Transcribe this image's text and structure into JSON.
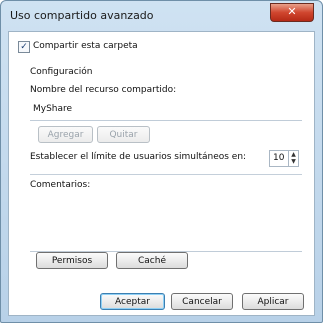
{
  "window": {
    "title": "Uso compartido avanzado",
    "close_symbol": "✕"
  },
  "share": {
    "checkbox_label": "Compartir esta carpeta",
    "checked": true
  },
  "config": {
    "section_label": "Configuración",
    "share_name_label": "Nombre del recurso compartido:",
    "share_name_value": "MyShare",
    "add_button": "Agregar",
    "remove_button": "Quitar",
    "limit_label": "Establecer el límite de usuarios simultáneos en:",
    "limit_value": "10",
    "comments_label": "Comentarios:",
    "comments_value": ""
  },
  "buttons": {
    "permissions": "Permisos",
    "cache": "Caché",
    "ok": "Aceptar",
    "cancel": "Cancelar",
    "apply": "Aplicar"
  },
  "icons": {
    "checkmark": "✓",
    "up": "▲",
    "down": "▼"
  }
}
